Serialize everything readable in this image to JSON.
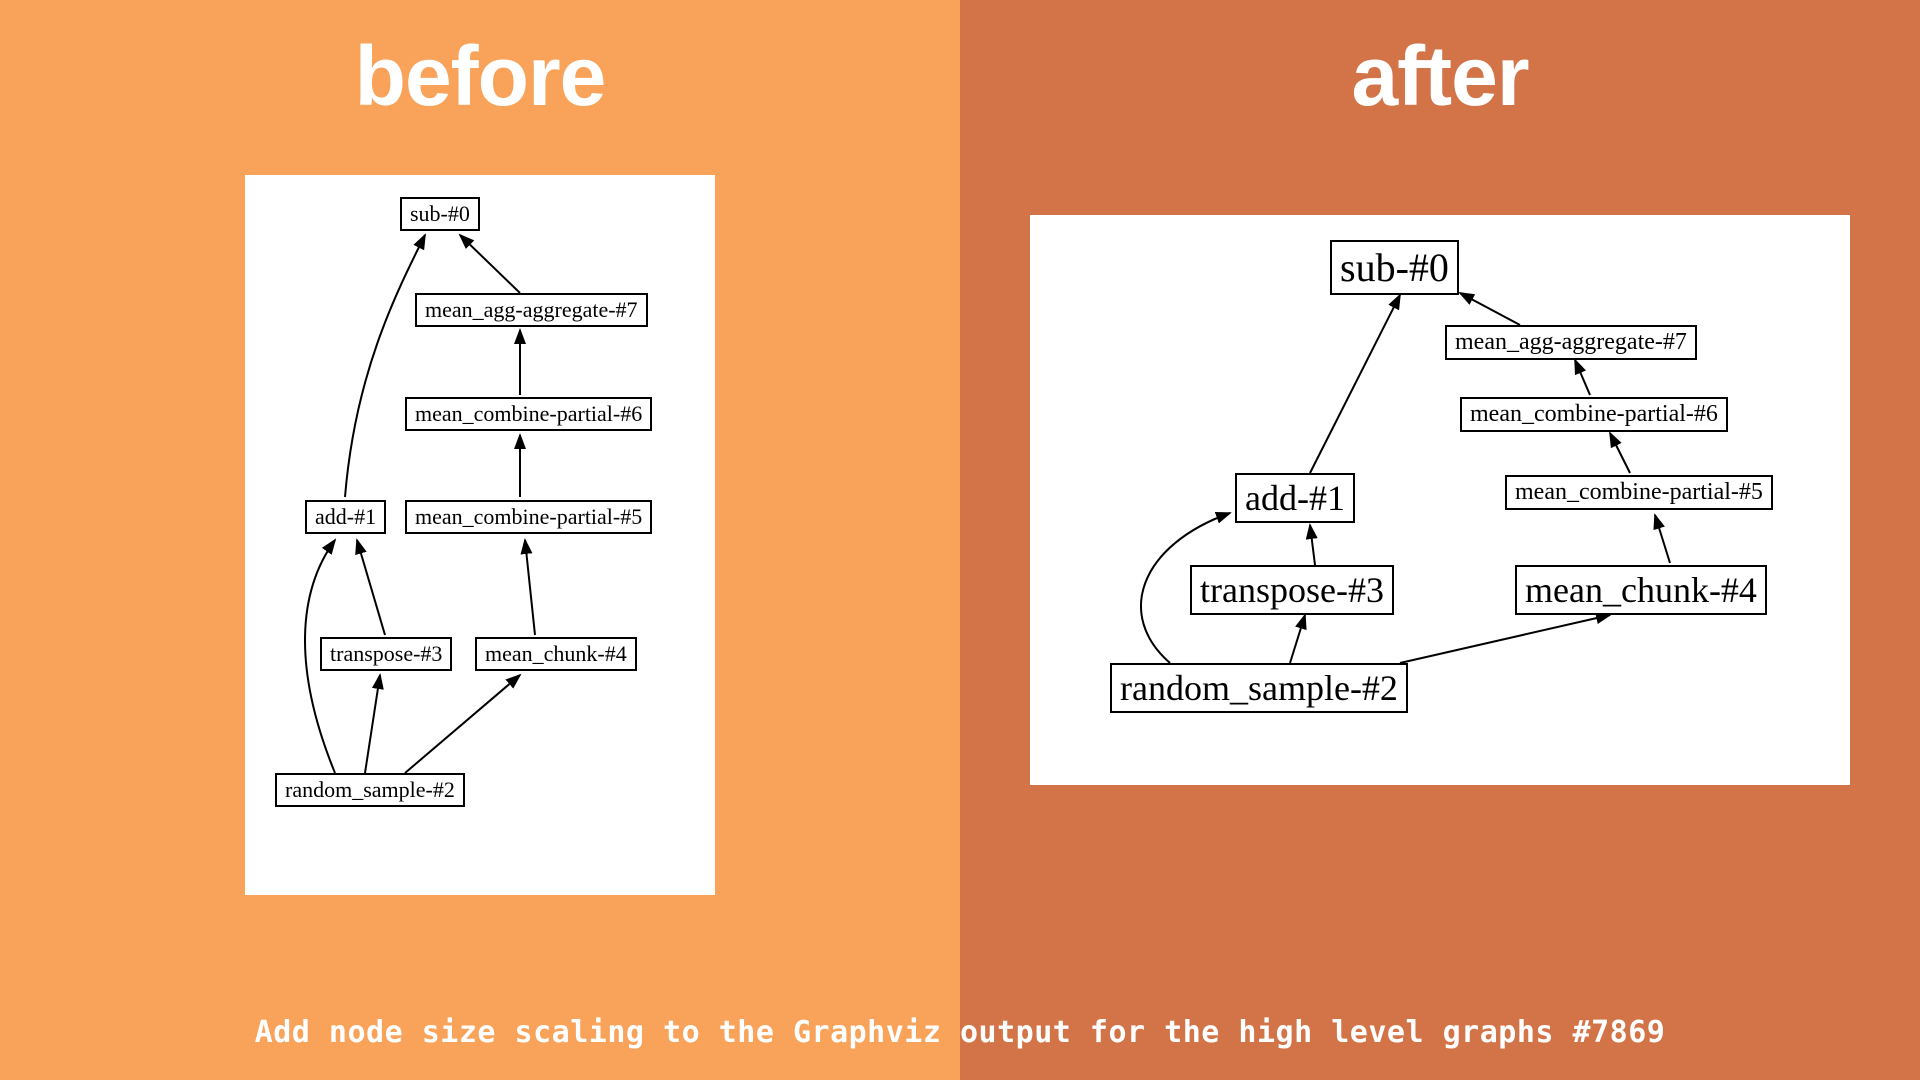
{
  "titles": {
    "left": "before",
    "right": "after"
  },
  "caption": "Add node size scaling to the Graphviz output for the high level graphs #7869",
  "nodes": {
    "sub0": "sub-#0",
    "mean_agg7": "mean_agg-aggregate-#7",
    "mean_combine6": "mean_combine-partial-#6",
    "mean_combine5": "mean_combine-partial-#5",
    "add1": "add-#1",
    "transpose3": "transpose-#3",
    "mean_chunk4": "mean_chunk-#4",
    "random_sample2": "random_sample-#2"
  }
}
